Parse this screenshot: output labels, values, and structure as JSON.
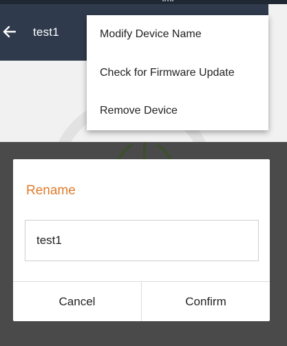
{
  "app_bar": {
    "title": "test1",
    "back_icon": "arrow-left-icon",
    "background": "#2f3b4c"
  },
  "menu": {
    "items": [
      {
        "label": "Modify Device Name"
      },
      {
        "label": "Check for Firmware Update"
      },
      {
        "label": "Remove Device"
      }
    ]
  },
  "dialog": {
    "title": "Rename",
    "title_color": "#e07a2a",
    "input_value": "test1",
    "cancel_label": "Cancel",
    "confirm_label": "Confirm"
  },
  "background_icon": "power-icon",
  "accent_power_color": "#4f8a2a"
}
